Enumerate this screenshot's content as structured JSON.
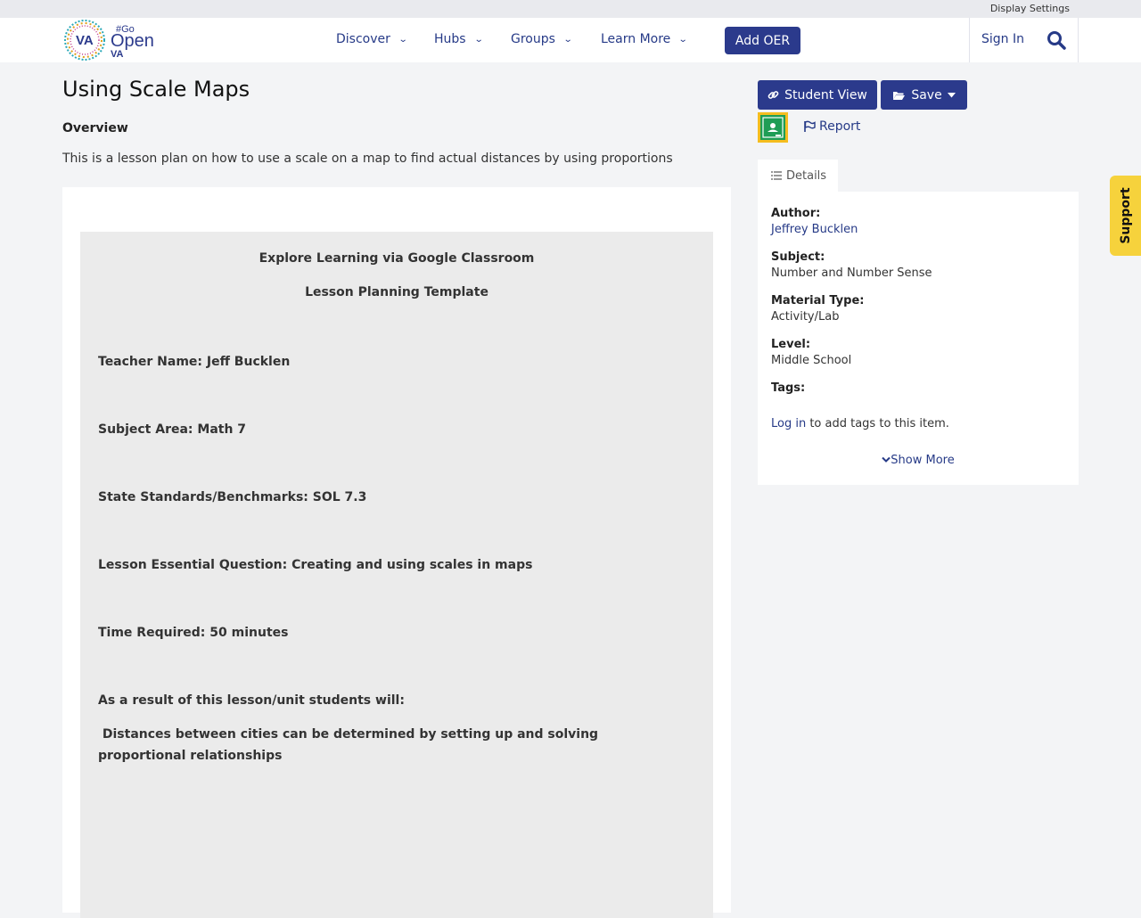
{
  "topbar": {
    "display_settings": "Display Settings"
  },
  "logo": {
    "va_left": "VA",
    "go": "#Go",
    "open": "Open",
    "va_small": "VA"
  },
  "nav": {
    "items": [
      {
        "label": "Discover"
      },
      {
        "label": "Hubs"
      },
      {
        "label": "Groups"
      },
      {
        "label": "Learn More"
      }
    ],
    "add_oer": "Add OER",
    "sign_in": "Sign In"
  },
  "page": {
    "title": "Using Scale Maps",
    "overview_heading": "Overview",
    "overview_text": "This is a lesson plan on how to use a scale on a map to find actual distances by using proportions"
  },
  "lesson": {
    "heading1": "Explore Learning via Google Classroom",
    "heading2": "Lesson Planning Template",
    "teacher": "Teacher Name:  Jeff Bucklen",
    "subject": "Subject Area:  Math 7",
    "standards": "State Standards/Benchmarks:  SOL  7.3",
    "question": "Lesson Essential Question:  Creating and using scales in maps",
    "time": "Time Required:  50 minutes",
    "result": "As a result of this lesson/unit students will:",
    "outcome": " Distances between cities can be determined by setting up and solving proportional relationships"
  },
  "actions": {
    "student_view": "Student View",
    "save": "Save",
    "report": "Report"
  },
  "details": {
    "tab_label": "Details",
    "author_label": "Author:",
    "author_value": "Jeffrey Bucklen",
    "subject_label": "Subject:",
    "subject_value": "Number and Number Sense",
    "material_label": "Material Type:",
    "material_value": "Activity/Lab",
    "level_label": "Level:",
    "level_value": "Middle School",
    "tags_label": "Tags:",
    "login_link": "Log in",
    "login_suffix": " to add tags to this item.",
    "show_more": "Show More"
  },
  "support": {
    "label": "Support"
  },
  "colors": {
    "brand": "#2b3a8c",
    "link": "#263a87",
    "support": "#f6d23c",
    "classroom": "#1f9d55"
  }
}
